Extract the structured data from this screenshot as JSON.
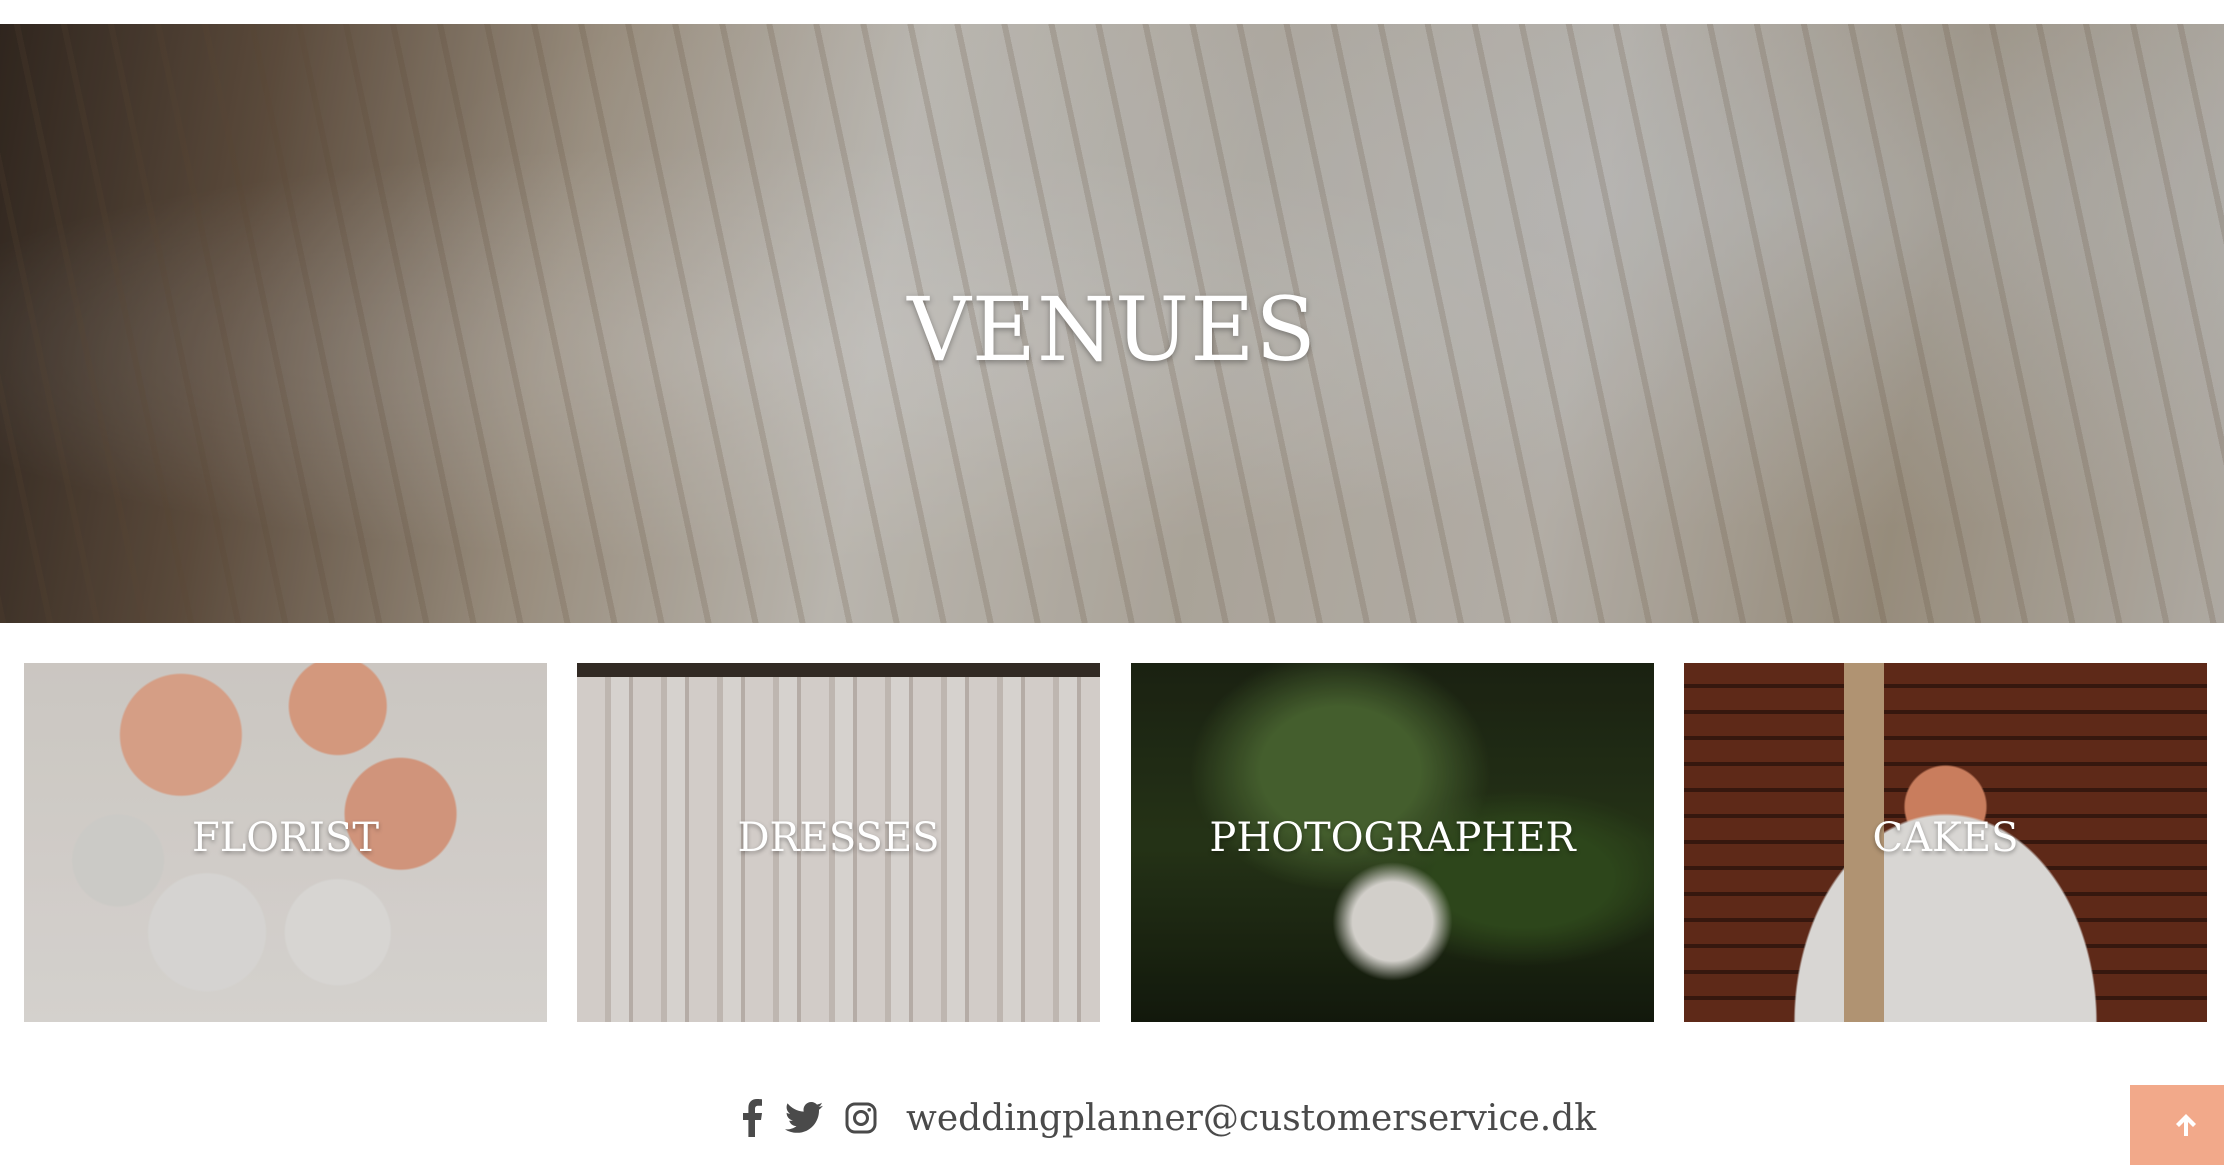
{
  "hero": {
    "title": "VENUES"
  },
  "categories": [
    {
      "label": "FLORIST"
    },
    {
      "label": "DRESSES"
    },
    {
      "label": "PHOTOGRAPHER"
    },
    {
      "label": "CAKES"
    }
  ],
  "footer": {
    "social_icons": [
      "facebook-icon",
      "twitter-icon",
      "instagram-icon"
    ],
    "email": "weddingplanner@customerservice.dk"
  },
  "scroll_top": {
    "icon": "arrow-up-icon",
    "color": "#f2a98a"
  }
}
